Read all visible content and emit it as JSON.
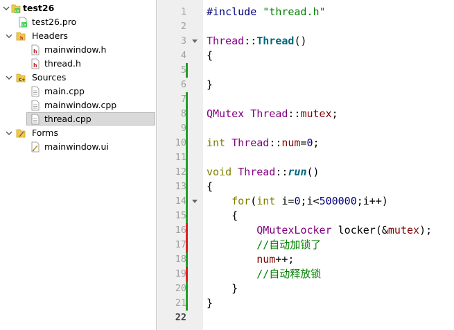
{
  "tree": {
    "project": "test26",
    "pro_file": "test26.pro",
    "headers_label": "Headers",
    "headers": [
      "mainwindow.h",
      "thread.h"
    ],
    "sources_label": "Sources",
    "sources": [
      "main.cpp",
      "mainwindow.cpp",
      "thread.cpp"
    ],
    "forms_label": "Forms",
    "forms": [
      "mainwindow.ui"
    ],
    "selected": "thread.cpp"
  },
  "editor": {
    "current_line": 22,
    "colors": {
      "gutter_bg": "#efefef",
      "change_green": "#21a021",
      "change_red": "#e02020",
      "keyword": "#808000",
      "class": "#800080",
      "function": "#00677c",
      "string": "#008000",
      "comment": "#008000"
    },
    "lines": [
      {
        "n": "1",
        "mark": "",
        "fold": false,
        "tokens": [
          {
            "t": "#include ",
            "c": "macro"
          },
          {
            "t": "\"thread.h\"",
            "c": "str"
          }
        ]
      },
      {
        "n": "2",
        "mark": "",
        "fold": false,
        "tokens": []
      },
      {
        "n": "3",
        "mark": "",
        "fold": true,
        "tokens": [
          {
            "t": "Thread",
            "c": "cls"
          },
          {
            "t": "::",
            "c": "op"
          },
          {
            "t": "Thread",
            "c": "func"
          },
          {
            "t": "()",
            "c": "plain"
          }
        ]
      },
      {
        "n": "4",
        "mark": "",
        "fold": false,
        "tokens": [
          {
            "t": "{",
            "c": "plain"
          }
        ]
      },
      {
        "n": "5",
        "mark": "green",
        "fold": false,
        "tokens": []
      },
      {
        "n": "6",
        "mark": "",
        "fold": false,
        "tokens": [
          {
            "t": "}",
            "c": "plain"
          }
        ]
      },
      {
        "n": "7",
        "mark": "green",
        "fold": false,
        "tokens": []
      },
      {
        "n": "8",
        "mark": "green",
        "fold": false,
        "tokens": [
          {
            "t": "QMutex",
            "c": "cls"
          },
          {
            "t": " ",
            "c": "plain"
          },
          {
            "t": "Thread",
            "c": "cls"
          },
          {
            "t": "::",
            "c": "op"
          },
          {
            "t": "mutex",
            "c": "member"
          },
          {
            "t": ";",
            "c": "plain"
          }
        ]
      },
      {
        "n": "9",
        "mark": "green",
        "fold": false,
        "tokens": []
      },
      {
        "n": "10",
        "mark": "green",
        "fold": false,
        "tokens": [
          {
            "t": "int",
            "c": "kw"
          },
          {
            "t": " ",
            "c": "plain"
          },
          {
            "t": "Thread",
            "c": "cls"
          },
          {
            "t": "::",
            "c": "op"
          },
          {
            "t": "num",
            "c": "member"
          },
          {
            "t": "=",
            "c": "plain"
          },
          {
            "t": "0",
            "c": "num"
          },
          {
            "t": ";",
            "c": "plain"
          }
        ]
      },
      {
        "n": "11",
        "mark": "green",
        "fold": false,
        "tokens": []
      },
      {
        "n": "12",
        "mark": "green",
        "fold": false,
        "tokens": [
          {
            "t": "void",
            "c": "kw"
          },
          {
            "t": " ",
            "c": "plain"
          },
          {
            "t": "Thread",
            "c": "cls"
          },
          {
            "t": "::",
            "c": "op"
          },
          {
            "t": "run",
            "c": "funci"
          },
          {
            "t": "()",
            "c": "plain"
          }
        ]
      },
      {
        "n": "13",
        "mark": "green",
        "fold": false,
        "tokens": [
          {
            "t": "{",
            "c": "plain"
          }
        ]
      },
      {
        "n": "14",
        "mark": "green",
        "fold": true,
        "tokens": [
          {
            "t": "    ",
            "c": "plain"
          },
          {
            "t": "for",
            "c": "kw"
          },
          {
            "t": "(",
            "c": "plain"
          },
          {
            "t": "int",
            "c": "kw"
          },
          {
            "t": " i=",
            "c": "plain"
          },
          {
            "t": "0",
            "c": "num"
          },
          {
            "t": ";i<",
            "c": "plain"
          },
          {
            "t": "500000",
            "c": "num"
          },
          {
            "t": ";i++)",
            "c": "plain"
          }
        ]
      },
      {
        "n": "15",
        "mark": "green",
        "fold": false,
        "tokens": [
          {
            "t": "    {",
            "c": "plain"
          }
        ]
      },
      {
        "n": "16",
        "mark": "red",
        "fold": false,
        "tokens": [
          {
            "t": "        ",
            "c": "plain"
          },
          {
            "t": "QMutexLocker",
            "c": "cls"
          },
          {
            "t": " locker(&",
            "c": "plain"
          },
          {
            "t": "mutex",
            "c": "member"
          },
          {
            "t": ");",
            "c": "plain"
          }
        ]
      },
      {
        "n": "17",
        "mark": "red",
        "fold": false,
        "tokens": [
          {
            "t": "        ",
            "c": "plain"
          },
          {
            "t": "//自动加锁了",
            "c": "cmt"
          }
        ]
      },
      {
        "n": "18",
        "mark": "green",
        "fold": false,
        "tokens": [
          {
            "t": "        ",
            "c": "plain"
          },
          {
            "t": "num",
            "c": "member"
          },
          {
            "t": "++;",
            "c": "plain"
          }
        ]
      },
      {
        "n": "19",
        "mark": "red",
        "fold": false,
        "tokens": [
          {
            "t": "        ",
            "c": "plain"
          },
          {
            "t": "//自动释放锁",
            "c": "cmt"
          }
        ]
      },
      {
        "n": "20",
        "mark": "green",
        "fold": false,
        "tokens": [
          {
            "t": "    }",
            "c": "plain"
          }
        ]
      },
      {
        "n": "21",
        "mark": "green",
        "fold": false,
        "tokens": [
          {
            "t": "}",
            "c": "plain"
          }
        ]
      },
      {
        "n": "22",
        "mark": "",
        "fold": false,
        "tokens": []
      }
    ]
  }
}
